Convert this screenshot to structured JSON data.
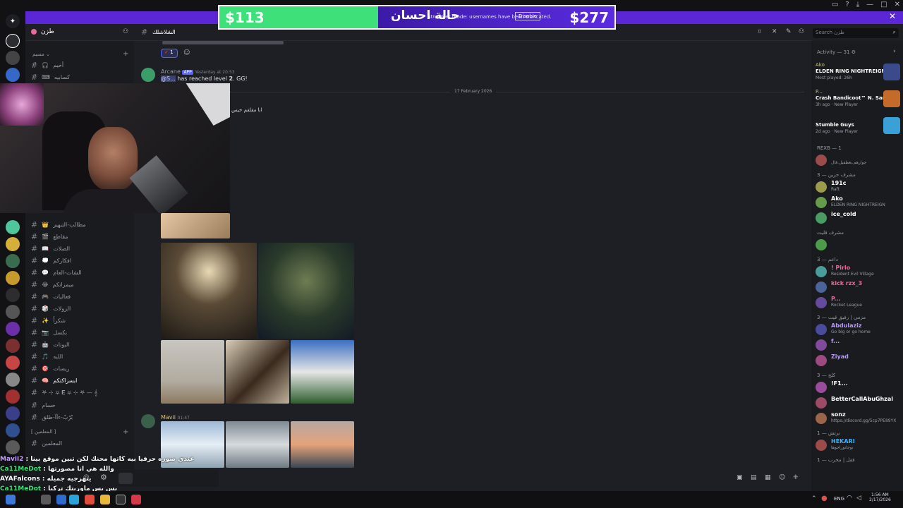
{
  "window": {
    "controls": [
      "▭",
      "?",
      "⤓",
      "—",
      "□",
      "✕"
    ]
  },
  "banner": {
    "text": "Streamer mode: usernames have been truncated.",
    "disable_label": "Disable",
    "close": "✕"
  },
  "donation": {
    "current": "$113",
    "name": "حالة احسان",
    "goal": "$277"
  },
  "server": {
    "name": "طزن"
  },
  "channel": {
    "name": "الشلاشلك"
  },
  "toolbar": {
    "search_placeholder": "Search طزن"
  },
  "sidebar": {
    "category_label": "مسيم",
    "channels_top": [
      {
        "label": "أخيم",
        "icon": "🎧"
      },
      {
        "label": "كسابيه",
        "icon": "⌨"
      }
    ],
    "channels": [
      {
        "label": "مطالب-التبهير",
        "emoji": "👑"
      },
      {
        "label": "مقاطع",
        "emoji": "🎬"
      },
      {
        "label": "الصلات",
        "emoji": "📖"
      },
      {
        "label": "افكاركم",
        "emoji": "💭"
      },
      {
        "label": "الشات-العام",
        "emoji": "💬"
      },
      {
        "label": "ميمزاتكم",
        "emoji": "😂"
      },
      {
        "label": "فعاليات",
        "emoji": "🎮"
      },
      {
        "label": "الرولات",
        "emoji": "🎲"
      },
      {
        "label": "شكراً",
        "emoji": "✨"
      },
      {
        "label": "بكسل",
        "emoji": "📷"
      },
      {
        "label": "البوتات",
        "emoji": "🤖"
      },
      {
        "label": "اللبه",
        "emoji": "🎵"
      },
      {
        "label": "ريسات",
        "emoji": "🎯"
      },
      {
        "label": "ابسزاكتكم",
        "emoji": "🧠"
      }
    ],
    "extra": [
      "𖤐 ⊹ ⛧ 𝐄 ⛧ ⊹ 𖤐 — 𝄞",
      "حسام",
      "بْرْبْ-ءآآ-طلق"
    ],
    "category2": "[ المعلمين ]",
    "channel_last": "المعلمين"
  },
  "messages": {
    "reaction_count": "1",
    "msg1": {
      "author": "Arcane",
      "badge": "APP",
      "time": "Yesterday at 20:53",
      "mention": "@S...",
      "text": "has reached level",
      "level": "2",
      "suffix": ". GG!"
    },
    "divider_date": "17 February 2026",
    "arabic_line": "انا مقلقم حيس",
    "msg2": {
      "author": "Mavii",
      "time": "01:47"
    }
  },
  "members": {
    "activity_label": "Activity — 31",
    "activities": [
      {
        "name": "Ako",
        "activity": "ELDEN RING NIGHTREIGN",
        "meta": "Most played: 26h"
      },
      {
        "name": "P...",
        "activity": "Crash Bandicoot™ N. Sane ...",
        "meta": "3h ago · New Player"
      },
      {
        "name": "",
        "activity": "Stumble Guys",
        "meta": "2d ago · New Player"
      }
    ],
    "groups": [
      {
        "label": "REXB — 1",
        "rows": [
          {
            "name": "",
            "sub": "جوارهم.بعظفيل.فال"
          }
        ]
      },
      {
        "label": "مشرف حزين — 3",
        "rows": [
          {
            "name": "191c",
            "sub": "Raft"
          },
          {
            "name": "Ako",
            "sub": "ELDEN RING NIGHTREIGN"
          },
          {
            "name": "ice_cold",
            "sub": ""
          }
        ]
      },
      {
        "label": "مشرف قليت",
        "rows": [
          {
            "name": "",
            "sub": ""
          }
        ]
      },
      {
        "label": "داعم — 3",
        "rows": [
          {
            "name": "! Pirlo",
            "sub": "Resident Evil Village"
          },
          {
            "name": "kick rzx_3",
            "sub": ""
          },
          {
            "name": "P...",
            "sub": "Rocket League"
          }
        ]
      },
      {
        "label": "مزمي | رفيق قيت — 3",
        "rows": [
          {
            "name": "Abdulaziz",
            "sub": "Go big or go home"
          },
          {
            "name": "f...",
            "sub": ""
          },
          {
            "name": "Ziyad",
            "sub": ""
          }
        ]
      },
      {
        "label": "كلخ — 3",
        "rows": [
          {
            "name": "!F1...",
            "sub": ""
          },
          {
            "name": "BetterCallAbuGhzal",
            "sub": ""
          },
          {
            "name": "sonz",
            "sub": "https://discord.gg/5cp7PE89YX"
          }
        ]
      },
      {
        "label": "نرتش — 1",
        "rows": [
          {
            "name": "HEKARI",
            "sub": "نوجاتوراجوها"
          }
        ]
      },
      {
        "label": "فقل | مخرب — 1",
        "rows": []
      }
    ]
  },
  "stream_chat": [
    {
      "user": "Mavii2",
      "msg": "عندي صوره حرفيا بيه كاتها محنك لكن تبين موقع بينا"
    },
    {
      "user": "Ca11MeDot",
      "msg": "والله هي انا مصورتها"
    },
    {
      "user": "AYAFalcons",
      "msg": "ينهزجيه جميله"
    },
    {
      "user": "Ca11MeDot",
      "msg": "بس بس ماوريتك تركيا"
    },
    {
      "user": "Mavii2",
      "msg": "هيهيه بعدولي"
    }
  ],
  "taskbar": {
    "lang": "ENG",
    "time": "1:56 AM",
    "date": "2/17/2026"
  },
  "colors": {
    "accent": "#5865f2",
    "banner": "#5b27d6",
    "donation_green": "#3ee07a"
  }
}
